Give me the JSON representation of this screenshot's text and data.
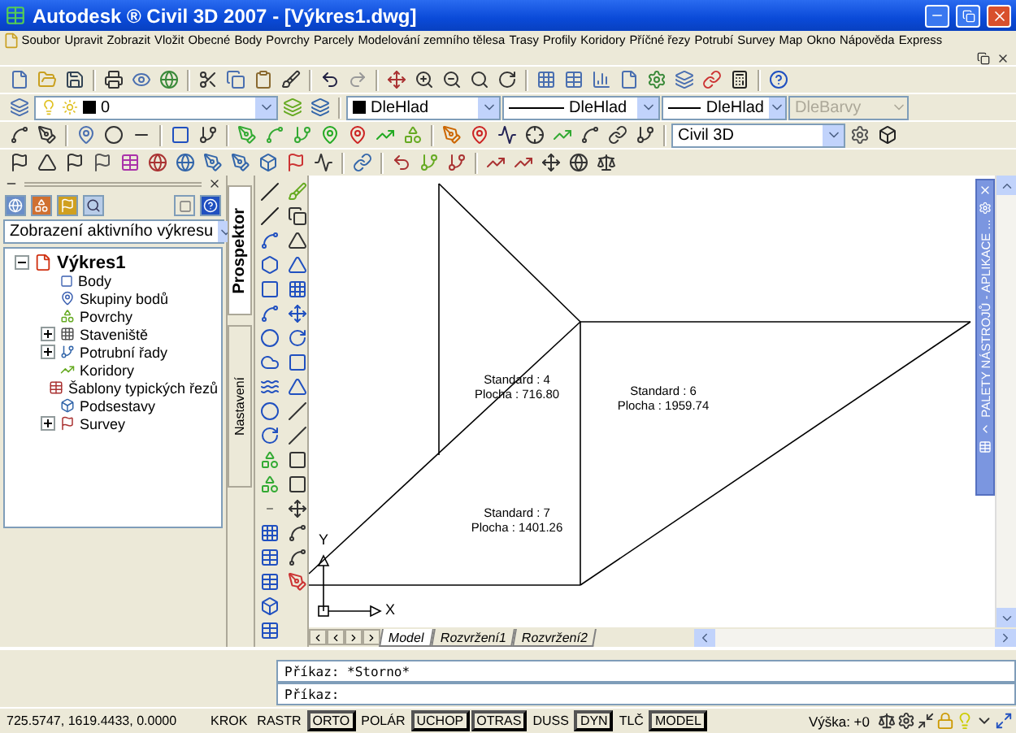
{
  "window": {
    "title": "Autodesk ® Civil 3D 2007 - [Výkres1.dwg]"
  },
  "menu": [
    "Soubor",
    "Upravit",
    "Zobrazit",
    "Vložit",
    "Obecné",
    "Body",
    "Povrchy",
    "Parcely",
    "Modelování zemního tělesa",
    "Trasy",
    "Profily",
    "Koridory",
    "Příčné řezy",
    "Potrubí",
    "Survey",
    "Map",
    "Okno",
    "Nápověda",
    "Express"
  ],
  "layer_bar": {
    "layer": "0",
    "color_setting": "DleHlad",
    "linetype": "DleHlad",
    "lineweight": "DleHlad",
    "plot_style": {
      "value": "DleBarvy",
      "disabled": true
    }
  },
  "workspace": "Civil 3D",
  "prospector": {
    "view": "Zobrazení aktivního výkresu",
    "tree": {
      "label": "Výkres1",
      "expanded": true,
      "children": [
        {
          "label": "Body"
        },
        {
          "label": "Skupiny bodů"
        },
        {
          "label": "Povrchy"
        },
        {
          "label": "Staveniště",
          "expanded": false
        },
        {
          "label": "Potrubní řady",
          "expanded": false
        },
        {
          "label": "Koridory"
        },
        {
          "label": "Šablony typických řezů"
        },
        {
          "label": "Podsestavy"
        },
        {
          "label": "Survey",
          "expanded": false
        }
      ]
    }
  },
  "side_tabs": [
    {
      "label": "Prospektor",
      "selected": true
    },
    {
      "label": "Nastavení",
      "selected": false
    }
  ],
  "drawing": {
    "labels": [
      [
        "Standard : 4",
        "Plocha : 716.80"
      ],
      [
        "Standard : 6",
        "Plocha : 1959.74"
      ],
      [
        "Standard : 7",
        "Plocha : 1401.26"
      ]
    ],
    "ucs": {
      "x": "X",
      "y": "Y"
    }
  },
  "layout_tabs": [
    {
      "label": "Model",
      "selected": true
    },
    {
      "label": "Rozvržení1",
      "selected": false
    },
    {
      "label": "Rozvržení2",
      "selected": false
    }
  ],
  "tool_palette": {
    "title": "PALETY NÁSTROJŮ - APLIKACE ..."
  },
  "command": {
    "history": "Příkaz: *Storno*",
    "prompt": "Příkaz:"
  },
  "status_bar": {
    "coords": "725.5747, 1619.4433, 0.0000",
    "toggles": [
      {
        "label": "KROK",
        "on": false
      },
      {
        "label": "RASTR",
        "on": false
      },
      {
        "label": "ORTO",
        "on": true
      },
      {
        "label": "POLÁR",
        "on": false
      },
      {
        "label": "UCHOP",
        "on": true
      },
      {
        "label": "OTRAS",
        "on": true
      },
      {
        "label": "DUSS",
        "on": false
      },
      {
        "label": "DYN",
        "on": true
      },
      {
        "label": "TLČ",
        "on": false
      },
      {
        "label": "MODEL",
        "on": true
      }
    ],
    "annotation": "Výška: +0"
  }
}
